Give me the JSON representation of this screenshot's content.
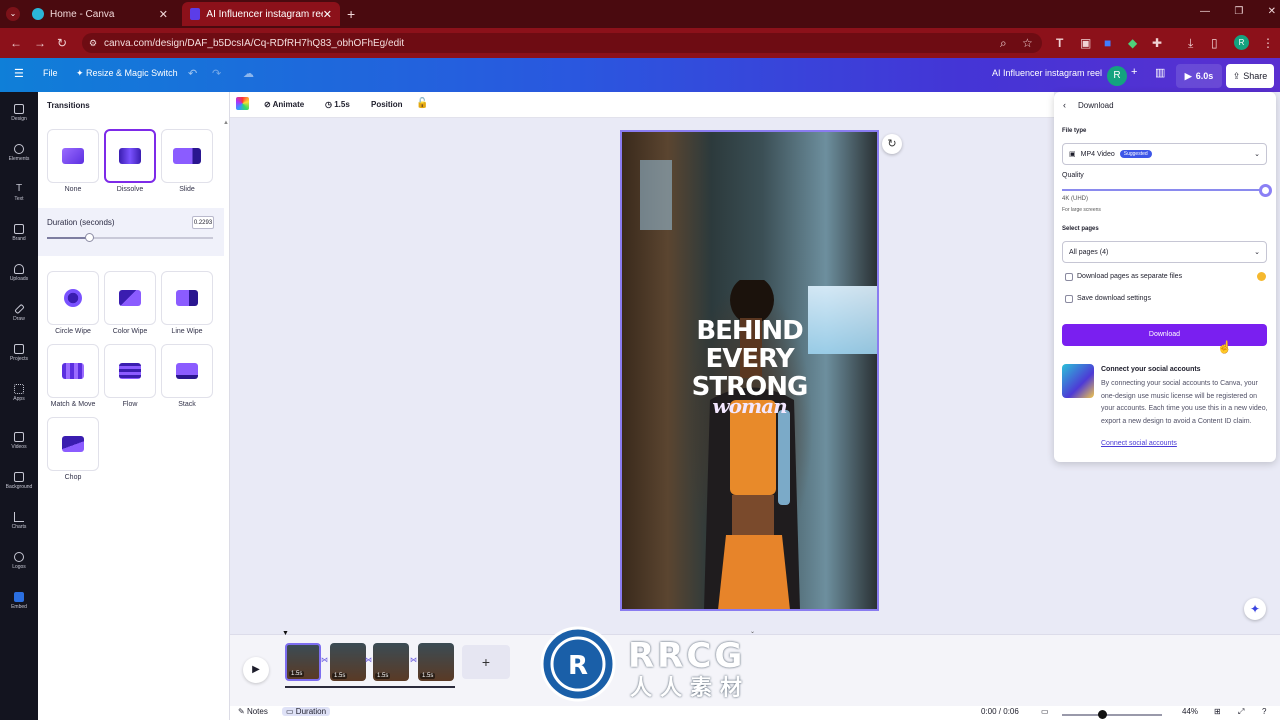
{
  "browser": {
    "tabs": [
      {
        "title": "Home - Canva"
      },
      {
        "title": "AI Influencer instagram reel - I"
      }
    ],
    "url": "canva.com/design/DAF_b5DcsIA/Cq-RDfRH7hQ83_obhOFhEg/edit"
  },
  "topbar": {
    "file_label": "File",
    "resize_label": "Resize & Magic Switch",
    "design_title": "AI Influencer instagram reel",
    "avatar_initial": "R",
    "play_duration": "6.0s",
    "share_label": "Share"
  },
  "rail": {
    "items": [
      "Design",
      "Elements",
      "Text",
      "Brand",
      "Uploads",
      "Draw",
      "Projects",
      "Apps",
      "Videos",
      "Background",
      "Charts",
      "Logos",
      "Embed"
    ]
  },
  "transitions": {
    "title": "Transitions",
    "top_row": [
      {
        "label": "None"
      },
      {
        "label": "Dissolve",
        "selected": true
      },
      {
        "label": "Slide"
      }
    ],
    "duration_label": "Duration (seconds)",
    "duration_value": "0.2293",
    "duration_fraction": 0.25,
    "grid": [
      {
        "label": "Circle Wipe"
      },
      {
        "label": "Color Wipe"
      },
      {
        "label": "Line Wipe"
      },
      {
        "label": "Match & Move"
      },
      {
        "label": "Flow"
      },
      {
        "label": "Stack"
      },
      {
        "label": "Chop"
      }
    ]
  },
  "toolbar": {
    "animate_label": "Animate",
    "duration_label": "1.5s",
    "position_label": "Position"
  },
  "canvas": {
    "headline": [
      "BEHIND",
      "EVERY",
      "STRONG"
    ],
    "script_word": "woman"
  },
  "download": {
    "title": "Download",
    "file_type_label": "File type",
    "file_type_value": "MP4 Video",
    "suggested_badge": "Suggested",
    "quality_label": "Quality",
    "quality_value": "4K (UHD)",
    "quality_hint": "For large screens",
    "quality_fraction": 1.0,
    "select_pages_label": "Select pages",
    "select_pages_value": "All pages (4)",
    "separate_files_label": "Download pages as separate files",
    "save_settings_label": "Save download settings",
    "download_button": "Download",
    "social_title": "Connect your social accounts",
    "social_text": "By connecting your social accounts to Canva, your one-design use music license will be registered on your accounts. Each time you use this in a new video, export a new design to avoid a Content ID claim.",
    "social_link": "Connect social accounts"
  },
  "timeline": {
    "clips": [
      "1.5s",
      "1.5s",
      "1.5s",
      "1.5s"
    ],
    "add_label": "+"
  },
  "bottombar": {
    "notes_label": "Notes",
    "duration_label": "Duration",
    "time": "0:00 / 0:06",
    "zoom": "44%"
  },
  "watermark": {
    "text": "RRCG",
    "subtext": "人人素材"
  },
  "colors": {
    "accent": "#7d2ae8",
    "browser_frame": "#8c111a",
    "topbar_start": "#0f7fd8",
    "topbar_end": "#5a2fd0"
  }
}
